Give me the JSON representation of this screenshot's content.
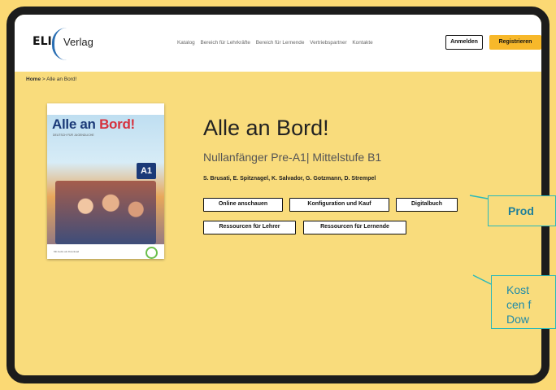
{
  "header": {
    "logo_mark": "ELI",
    "logo_text": "Verlag",
    "nav": [
      "Katalog",
      "Bereich für Lehrkräfte",
      "Bereich für Lernende",
      "Vertriebspartner",
      "Kontakte"
    ],
    "login_label": "Anmelden",
    "register_label": "Registrieren"
  },
  "breadcrumb": {
    "home": "Home",
    "separator": ">",
    "current": "Alle an Bord!"
  },
  "cover": {
    "title_part1": "Alle an ",
    "title_part2": "Bord!",
    "subtitle": "DEUTSCH FÜR JUGENDLICHE",
    "level": "A1",
    "footer_text": "Mit Audio als Download"
  },
  "product": {
    "title": "Alle an Bord!",
    "subtitle": "Nullanfänger Pre-A1| Mittelstufe B1",
    "authors": "S. Brusati, E. Spitznagel, K. Salvador, G. Gotzmann, D. Strempel",
    "buttons": {
      "online": "Online anschauen",
      "config": "Konfiguration und Kauf",
      "digital": "Digitalbuch",
      "teachers": "Ressourcen für Lehrer",
      "learners": "Ressourcen für Lernende"
    }
  },
  "callouts": {
    "first": "Prod",
    "second_lines": [
      "Kost",
      "cen f",
      "Dow"
    ]
  },
  "colors": {
    "background": "#f9dc7c",
    "accent": "#f7b82a",
    "callout_border": "#29b9ba",
    "frame": "#1c1c1c"
  }
}
